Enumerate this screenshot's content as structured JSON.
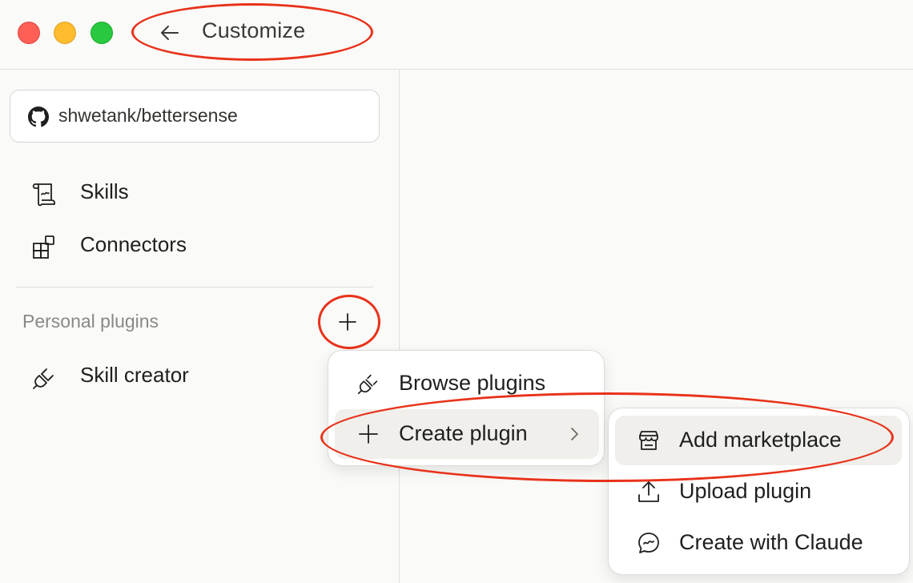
{
  "window": {
    "title": "Customize",
    "back_icon": "arrow-left-icon"
  },
  "sidebar": {
    "repo": {
      "label": "shwetank/bettersense",
      "icon": "github-icon"
    },
    "items": [
      {
        "label": "Skills",
        "icon": "scroll-icon"
      },
      {
        "label": "Connectors",
        "icon": "blocks-icon"
      }
    ],
    "section": {
      "label": "Personal plugins",
      "add_icon": "plus-icon"
    },
    "plugins": [
      {
        "label": "Skill creator",
        "icon": "plug-icon"
      }
    ]
  },
  "plugin_menu": {
    "items": [
      {
        "label": "Browse plugins",
        "icon": "plug-icon"
      },
      {
        "label": "Create plugin",
        "icon": "plus-icon",
        "submenu_icon": "chevron-right-icon"
      }
    ]
  },
  "create_submenu": {
    "items": [
      {
        "label": "Add marketplace",
        "icon": "store-icon"
      },
      {
        "label": "Upload plugin",
        "icon": "upload-icon"
      },
      {
        "label": "Create with Claude",
        "icon": "chat-bubble-icon"
      }
    ]
  },
  "colors": {
    "annotation": "#e8321a",
    "traffic_red": "#ff5f57",
    "traffic_yellow": "#febc2e",
    "traffic_green": "#28c840",
    "background": "#fafaf8"
  }
}
